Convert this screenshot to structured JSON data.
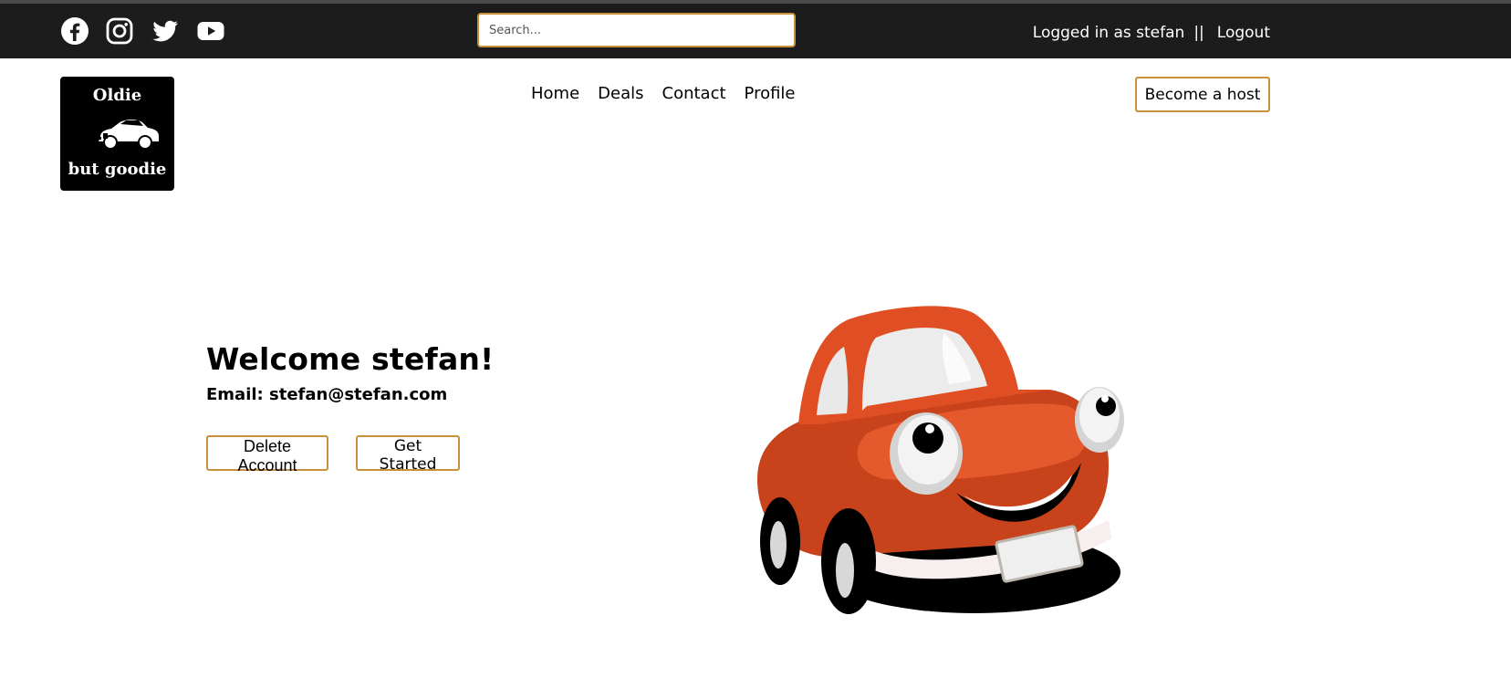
{
  "topbar": {
    "social_icons": [
      "facebook-icon",
      "instagram-icon",
      "twitter-icon",
      "youtube-icon"
    ],
    "search": {
      "placeholder": "Search...",
      "value": ""
    },
    "logged_in_text": "Logged in as stefan",
    "separator": "||",
    "logout_label": "Logout"
  },
  "logo": {
    "line1": "Oldie",
    "line2": "but goodie"
  },
  "nav": {
    "items": [
      "Home",
      "Deals",
      "Contact",
      "Profile"
    ]
  },
  "header": {
    "host_button": "Become a host"
  },
  "main": {
    "welcome": "Welcome stefan!",
    "email_label": "Email:",
    "email": "stefan@stefan.com",
    "email_line": "Email: stefan@stefan.com",
    "delete_button": "Delete Account",
    "get_started_button": "Get Started"
  },
  "colors": {
    "topbar_bg": "#1c1c1c",
    "accent_border": "#c8903a",
    "car_body": "#e04e23"
  }
}
